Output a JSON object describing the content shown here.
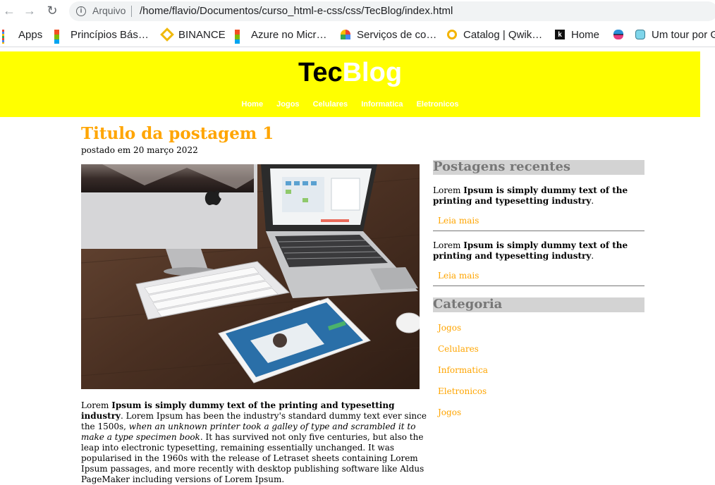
{
  "browser": {
    "url_scheme": "Arquivo",
    "url": "/home/flavio/Documentos/curso_html-e-css/css/TecBlog/index.html",
    "bookmarks": [
      "Apps",
      "Princípios Bás…",
      "BINANCE",
      "Azure no Micr…",
      "Serviços de co…",
      "Catalog | Qwik…",
      "Home",
      "",
      "Um tour por G"
    ]
  },
  "site": {
    "logo_part1": "Tec",
    "logo_part2": "Blog",
    "nav": [
      "Home",
      "Jogos",
      "Celulares",
      "Informatica",
      "Eletronicos"
    ]
  },
  "post": {
    "title": "Titulo da postagem 1",
    "date": "postado em 20 março 2022",
    "body_lead": "Lorem ",
    "body_bold": "Ipsum is simply dummy text of the printing and typesetting industry",
    "body_mid": ". Lorem Ipsum has been the industry's standard dummy text ever since the 1500s, ",
    "body_italic": "when an unknown printer took a galley of type and scrambled it to make a type specimen book",
    "body_tail": ". It has survived not only five centuries, but also the leap into electronic typesetting, remaining essentially unchanged. It was popularised in the 1960s with the release of Letraset sheets containing Lorem Ipsum passages, and more recently with desktop publishing software like Aldus PageMaker including versions of Lorem Ipsum."
  },
  "sidebar": {
    "recent_heading": "Postagens recentes",
    "recent": [
      {
        "lead": "Lorem ",
        "bold": "Ipsum is simply dummy text of the printing and typesetting industry",
        "end": ".",
        "link": "Leia mais"
      },
      {
        "lead": "Lorem ",
        "bold": "Ipsum is simply dummy text of the printing and typesetting industry",
        "end": ".",
        "link": "Leia mais"
      }
    ],
    "category_heading": "Categoria",
    "categories": [
      "Jogos",
      "Celulares",
      "Informatica",
      "Eletronicos",
      "Jogos"
    ]
  },
  "colors": {
    "header_bg": "#ffff00",
    "accent": "#ffa500",
    "sidebar_heading_bg": "#d3d3d3"
  }
}
